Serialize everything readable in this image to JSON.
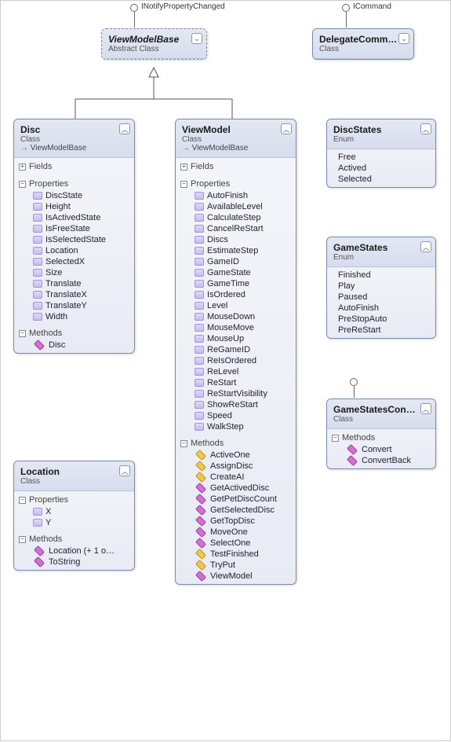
{
  "interfaces": {
    "inotify": "INotifyPropertyChanged",
    "icommand": "ICommand"
  },
  "viewModelBase": {
    "title": "ViewModelBase",
    "subtitle": "Abstract Class"
  },
  "delegateCommand": {
    "title": "DelegateComm…",
    "subtitle": "Class"
  },
  "disc": {
    "title": "Disc",
    "subtitle": "Class",
    "base": "ViewModelBase",
    "fieldsLabel": "Fields",
    "propsLabel": "Properties",
    "methodsLabel": "Methods",
    "properties": [
      "DiscState",
      "Height",
      "IsActivedState",
      "IsFreeState",
      "IsSelectedState",
      "Location",
      "SelectedX",
      "Size",
      "Translate",
      "TranslateX",
      "TranslateY",
      "Width"
    ],
    "methods": [
      "Disc"
    ]
  },
  "viewModel": {
    "title": "ViewModel",
    "subtitle": "Class",
    "base": "ViewModelBase",
    "fieldsLabel": "Fields",
    "propsLabel": "Properties",
    "methodsLabel": "Methods",
    "properties": [
      "AutoFinish",
      "AvailableLevel",
      "CalculateStep",
      "CancelReStart",
      "Discs",
      "EstimateStep",
      "GameID",
      "GameState",
      "GameTime",
      "IsOrdered",
      "Level",
      "MouseDown",
      "MouseMove",
      "MouseUp",
      "ReGameID",
      "ReIsOrdered",
      "ReLevel",
      "ReStart",
      "ReStartVisibility",
      "ShowReStart",
      "Speed",
      "WalkStep"
    ],
    "methods": [
      {
        "name": "ActiveOne",
        "kind": "y"
      },
      {
        "name": "AssignDisc",
        "kind": "y"
      },
      {
        "name": "CreateAI",
        "kind": "y"
      },
      {
        "name": "GetActivedDisc",
        "kind": "p"
      },
      {
        "name": "GetPetDiscCount",
        "kind": "p"
      },
      {
        "name": "GetSelectedDisc",
        "kind": "p"
      },
      {
        "name": "GetTopDisc",
        "kind": "p"
      },
      {
        "name": "MoveOne",
        "kind": "p"
      },
      {
        "name": "SelectOne",
        "kind": "p"
      },
      {
        "name": "TestFinished",
        "kind": "y"
      },
      {
        "name": "TryPut",
        "kind": "y"
      },
      {
        "name": "ViewModel",
        "kind": "p"
      }
    ]
  },
  "location": {
    "title": "Location",
    "subtitle": "Class",
    "propsLabel": "Properties",
    "methodsLabel": "Methods",
    "properties": [
      "X",
      "Y"
    ],
    "methods": [
      "Location (+ 1 o…",
      "ToString"
    ]
  },
  "discStates": {
    "title": "DiscStates",
    "subtitle": "Enum",
    "values": [
      "Free",
      "Actived",
      "Selected"
    ]
  },
  "gameStates": {
    "title": "GameStates",
    "subtitle": "Enum",
    "values": [
      "Finished",
      "Play",
      "Paused",
      "AutoFinish",
      "PreStopAuto",
      "PreReStart"
    ]
  },
  "gameStatesConv": {
    "title": "GameStatesCon…",
    "subtitle": "Class",
    "methodsLabel": "Methods",
    "methods": [
      "Convert",
      "ConvertBack"
    ]
  }
}
